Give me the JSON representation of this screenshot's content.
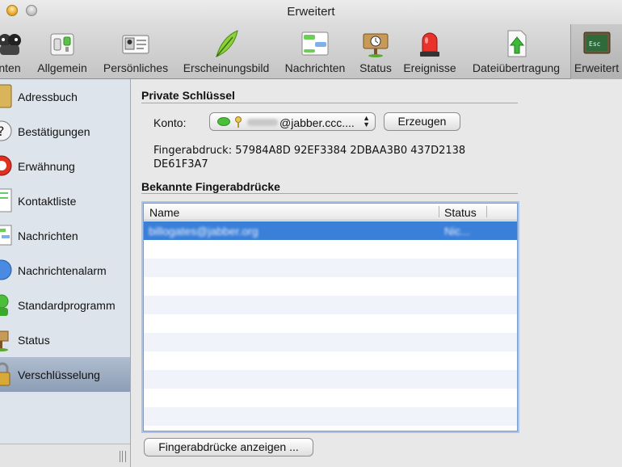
{
  "window": {
    "title": "Erweitert"
  },
  "toolbar": {
    "items": [
      {
        "label": "nten",
        "icon": "accounts-icon"
      },
      {
        "label": "Allgemein",
        "icon": "general-switch-icon"
      },
      {
        "label": "Persönliches",
        "icon": "personal-card-icon"
      },
      {
        "label": "Erscheinungsbild",
        "icon": "feather-icon"
      },
      {
        "label": "Nachrichten",
        "icon": "messages-icon"
      },
      {
        "label": "Status",
        "icon": "status-sign-icon"
      },
      {
        "label": "Ereignisse",
        "icon": "siren-icon"
      },
      {
        "label": "Dateiübertragung",
        "icon": "file-transfer-icon"
      },
      {
        "label": "Erweitert",
        "icon": "terminal-icon",
        "selected": true
      }
    ]
  },
  "sidebar": {
    "items": [
      {
        "label": "Adressbuch",
        "icon": "address-book-icon"
      },
      {
        "label": "Bestätigungen",
        "icon": "question-mark-icon"
      },
      {
        "label": "Erwähnung",
        "icon": "mention-icon"
      },
      {
        "label": "Kontaktliste",
        "icon": "contact-list-icon"
      },
      {
        "label": "Nachrichten",
        "icon": "messages-icon"
      },
      {
        "label": "Nachrichtenalarm",
        "icon": "message-alert-icon"
      },
      {
        "label": "Standardprogramm",
        "icon": "default-app-icon"
      },
      {
        "label": "Status",
        "icon": "status-sign-icon"
      },
      {
        "label": "Verschlüsselung",
        "icon": "lock-icon",
        "selected": true
      }
    ]
  },
  "private_keys": {
    "title": "Private Schlüssel",
    "account_label": "Konto:",
    "account_value": "@jabber.ccc....",
    "generate_button": "Erzeugen",
    "fingerprint_line1": "Fingerabdruck: 57984A8D 92EF3384 2DBAA3B0 437D2138",
    "fingerprint_line2": "DE61F3A7"
  },
  "known_fingerprints": {
    "title": "Bekannte Fingerabdrücke",
    "columns": [
      "Name",
      "Status"
    ],
    "rows": [
      {
        "name": "billogates@jabber.org",
        "status": "Nic..."
      }
    ],
    "show_button": "Fingerabdrücke anzeigen ..."
  },
  "colors": {
    "selection": "#3a7fd8",
    "sidebar_bg": "#dde4ec",
    "sidebar_selected": "#93a4bb"
  }
}
